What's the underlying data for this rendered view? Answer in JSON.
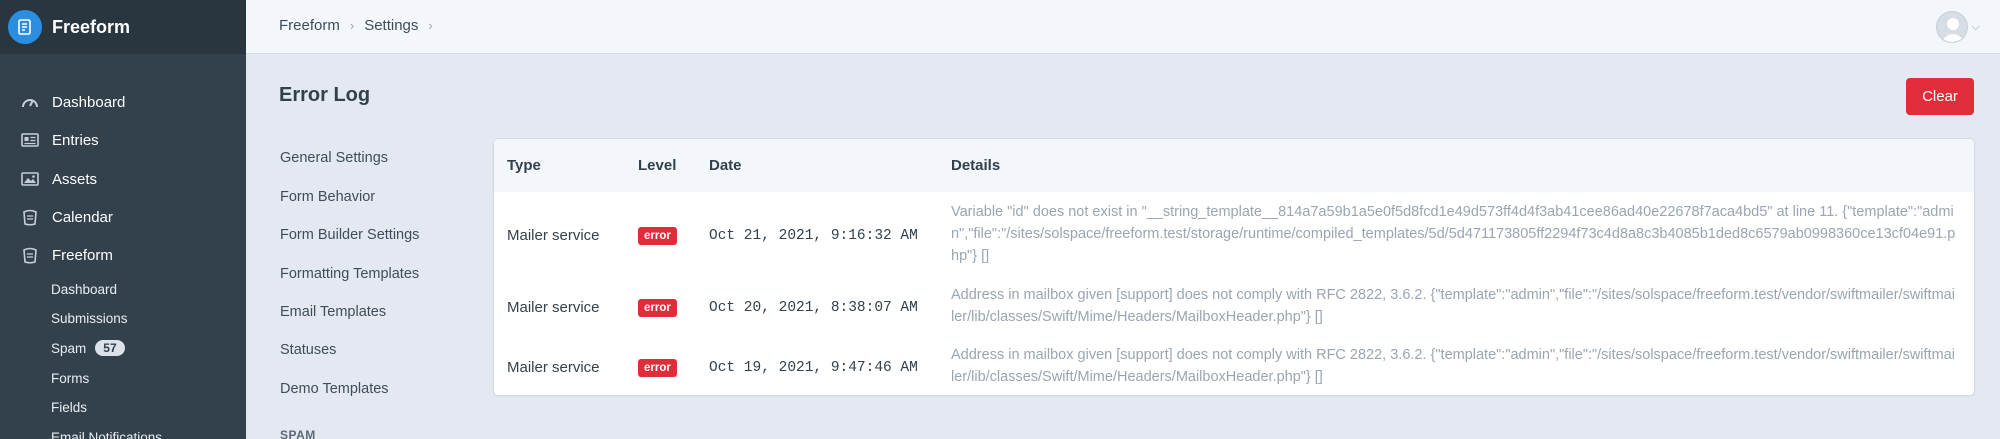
{
  "app": {
    "name": "Freeform"
  },
  "sidebar": {
    "items": [
      {
        "label": "Dashboard",
        "icon": "gauge-icon"
      },
      {
        "label": "Entries",
        "icon": "newspaper-icon"
      },
      {
        "label": "Assets",
        "icon": "image-icon"
      },
      {
        "label": "Calendar",
        "icon": "calendar-icon"
      },
      {
        "label": "Freeform",
        "icon": "freeform-icon"
      }
    ],
    "subitems": [
      {
        "label": "Dashboard"
      },
      {
        "label": "Submissions"
      },
      {
        "label": "Spam",
        "badge": "57"
      },
      {
        "label": "Forms"
      },
      {
        "label": "Fields"
      },
      {
        "label": "Email Notifications"
      }
    ]
  },
  "breadcrumbs": [
    "Freeform",
    "Settings"
  ],
  "page": {
    "title": "Error Log",
    "clear_label": "Clear"
  },
  "settings_nav": {
    "items": [
      "General Settings",
      "Form Behavior",
      "Form Builder Settings",
      "Formatting Templates",
      "Email Templates",
      "Statuses",
      "Demo Templates"
    ],
    "heading": "SPAM"
  },
  "table": {
    "headers": {
      "type": "Type",
      "level": "Level",
      "date": "Date",
      "details": "Details"
    },
    "rows": [
      {
        "type": "Mailer service",
        "level": "error",
        "date": "Oct 21, 2021, 9:16:32 AM",
        "details": "Variable \"id\" does not exist in \"__string_template__814a7a59b1a5e0f5d8fcd1e49d573ff4d4f3ab41cee86ad40e22678f7aca4bd5\" at line 11. {\"template\":\"admin\",\"file\":\"/sites/solspace/freeform.test/storage/runtime/compiled_templates/5d/5d471173805ff2294f73c4d8a8c3b4085b1ded8c6579ab0998360ce13cf04e91.php\"} []"
      },
      {
        "type": "Mailer service",
        "level": "error",
        "date": "Oct 20, 2021, 8:38:07 AM",
        "details": "Address in mailbox given [support] does not comply with RFC 2822, 3.6.2. {\"template\":\"admin\",\"file\":\"/sites/solspace/freeform.test/vendor/swiftmailer/swiftmailer/lib/classes/Swift/Mime/Headers/MailboxHeader.php\"} []"
      },
      {
        "type": "Mailer service",
        "level": "error",
        "date": "Oct 19, 2021, 9:47:46 AM",
        "details": "Address in mailbox given [support] does not comply with RFC 2822, 3.6.2. {\"template\":\"admin\",\"file\":\"/sites/solspace/freeform.test/vendor/swiftmailer/swiftmailer/lib/classes/Swift/Mime/Headers/MailboxHeader.php\"} []"
      }
    ]
  },
  "colors": {
    "sidebar": "#33414d",
    "accent": "#e12d39",
    "brand": "#2a8fe3"
  }
}
